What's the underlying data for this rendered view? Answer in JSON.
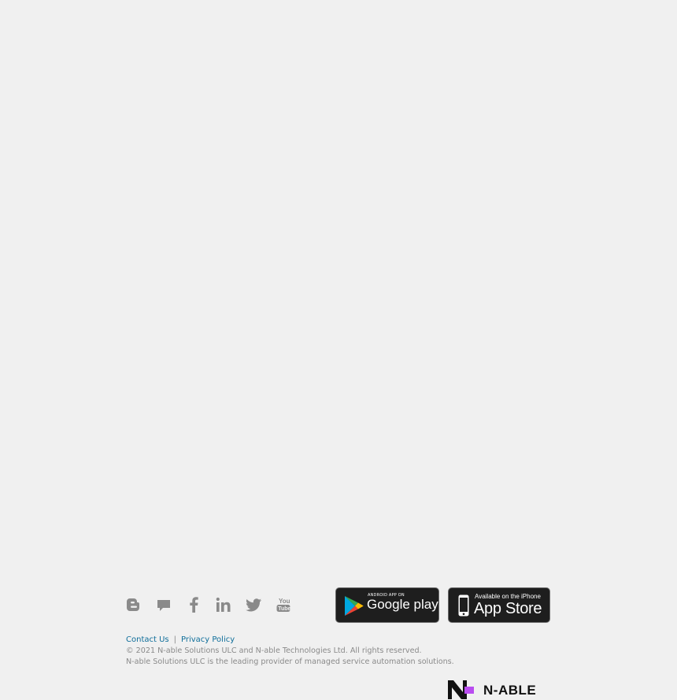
{
  "social": {
    "items": [
      {
        "name": "Blogger",
        "icon": "blogger-icon"
      },
      {
        "name": "Forum",
        "icon": "chat-bubble-icon"
      },
      {
        "name": "Facebook",
        "icon": "facebook-icon"
      },
      {
        "name": "LinkedIn",
        "icon": "linkedin-icon"
      },
      {
        "name": "Twitter",
        "icon": "twitter-icon"
      },
      {
        "name": "YouTube",
        "icon": "youtube-icon"
      }
    ],
    "icon_color": "#8a8a8a"
  },
  "app_badges": {
    "google": {
      "small_text": "ANDROID APP ON",
      "big_text": "Google play"
    },
    "apple": {
      "small_text": "Available on the iPhone",
      "big_text": "App Store"
    }
  },
  "footer": {
    "contact_label": "Contact Us",
    "separator": "|",
    "privacy_label": "Privacy Policy",
    "copyright": "© 2021 N-able Solutions ULC and N-able Technologies Ltd. All rights reserved.",
    "tagline": "N-able Solutions ULC is the leading provider of managed service automation solutions.",
    "link_color": "#0f6e9a",
    "text_color": "#8a8a8a"
  },
  "brand": {
    "logo_text": "N-ABLE",
    "accent_color": "#b94cf0"
  }
}
